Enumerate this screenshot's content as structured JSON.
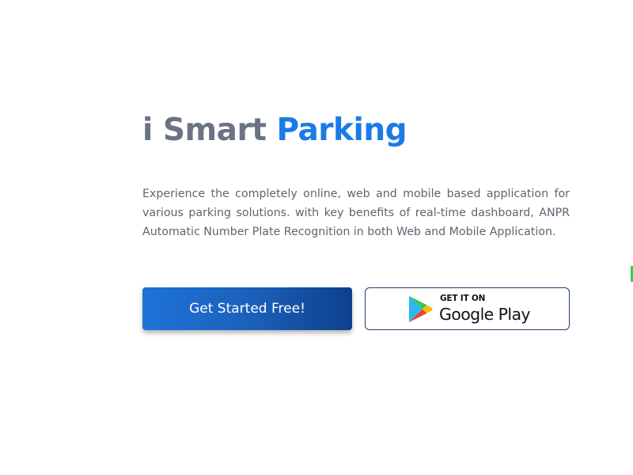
{
  "hero": {
    "title_part1": "i Smart",
    "title_part2": "Parking",
    "description": "Experience the completely online, web and mobile based application for various parking solutions. with key benefits of real-time dashboard, ANPR Automatic Number Plate Recognition in both Web and Mobile Application."
  },
  "actions": {
    "get_started_label": "Get Started Free!",
    "play_store_small": "GET IT ON",
    "play_store_big": "Google Play"
  },
  "colors": {
    "title_gray": "#6b7383",
    "title_blue": "#1a7be6",
    "button_gradient_start": "#1e73d8",
    "button_gradient_end": "#0e3f8c",
    "play_border": "#1e3f6a"
  },
  "icons": {
    "play_store": "google-play-icon"
  }
}
